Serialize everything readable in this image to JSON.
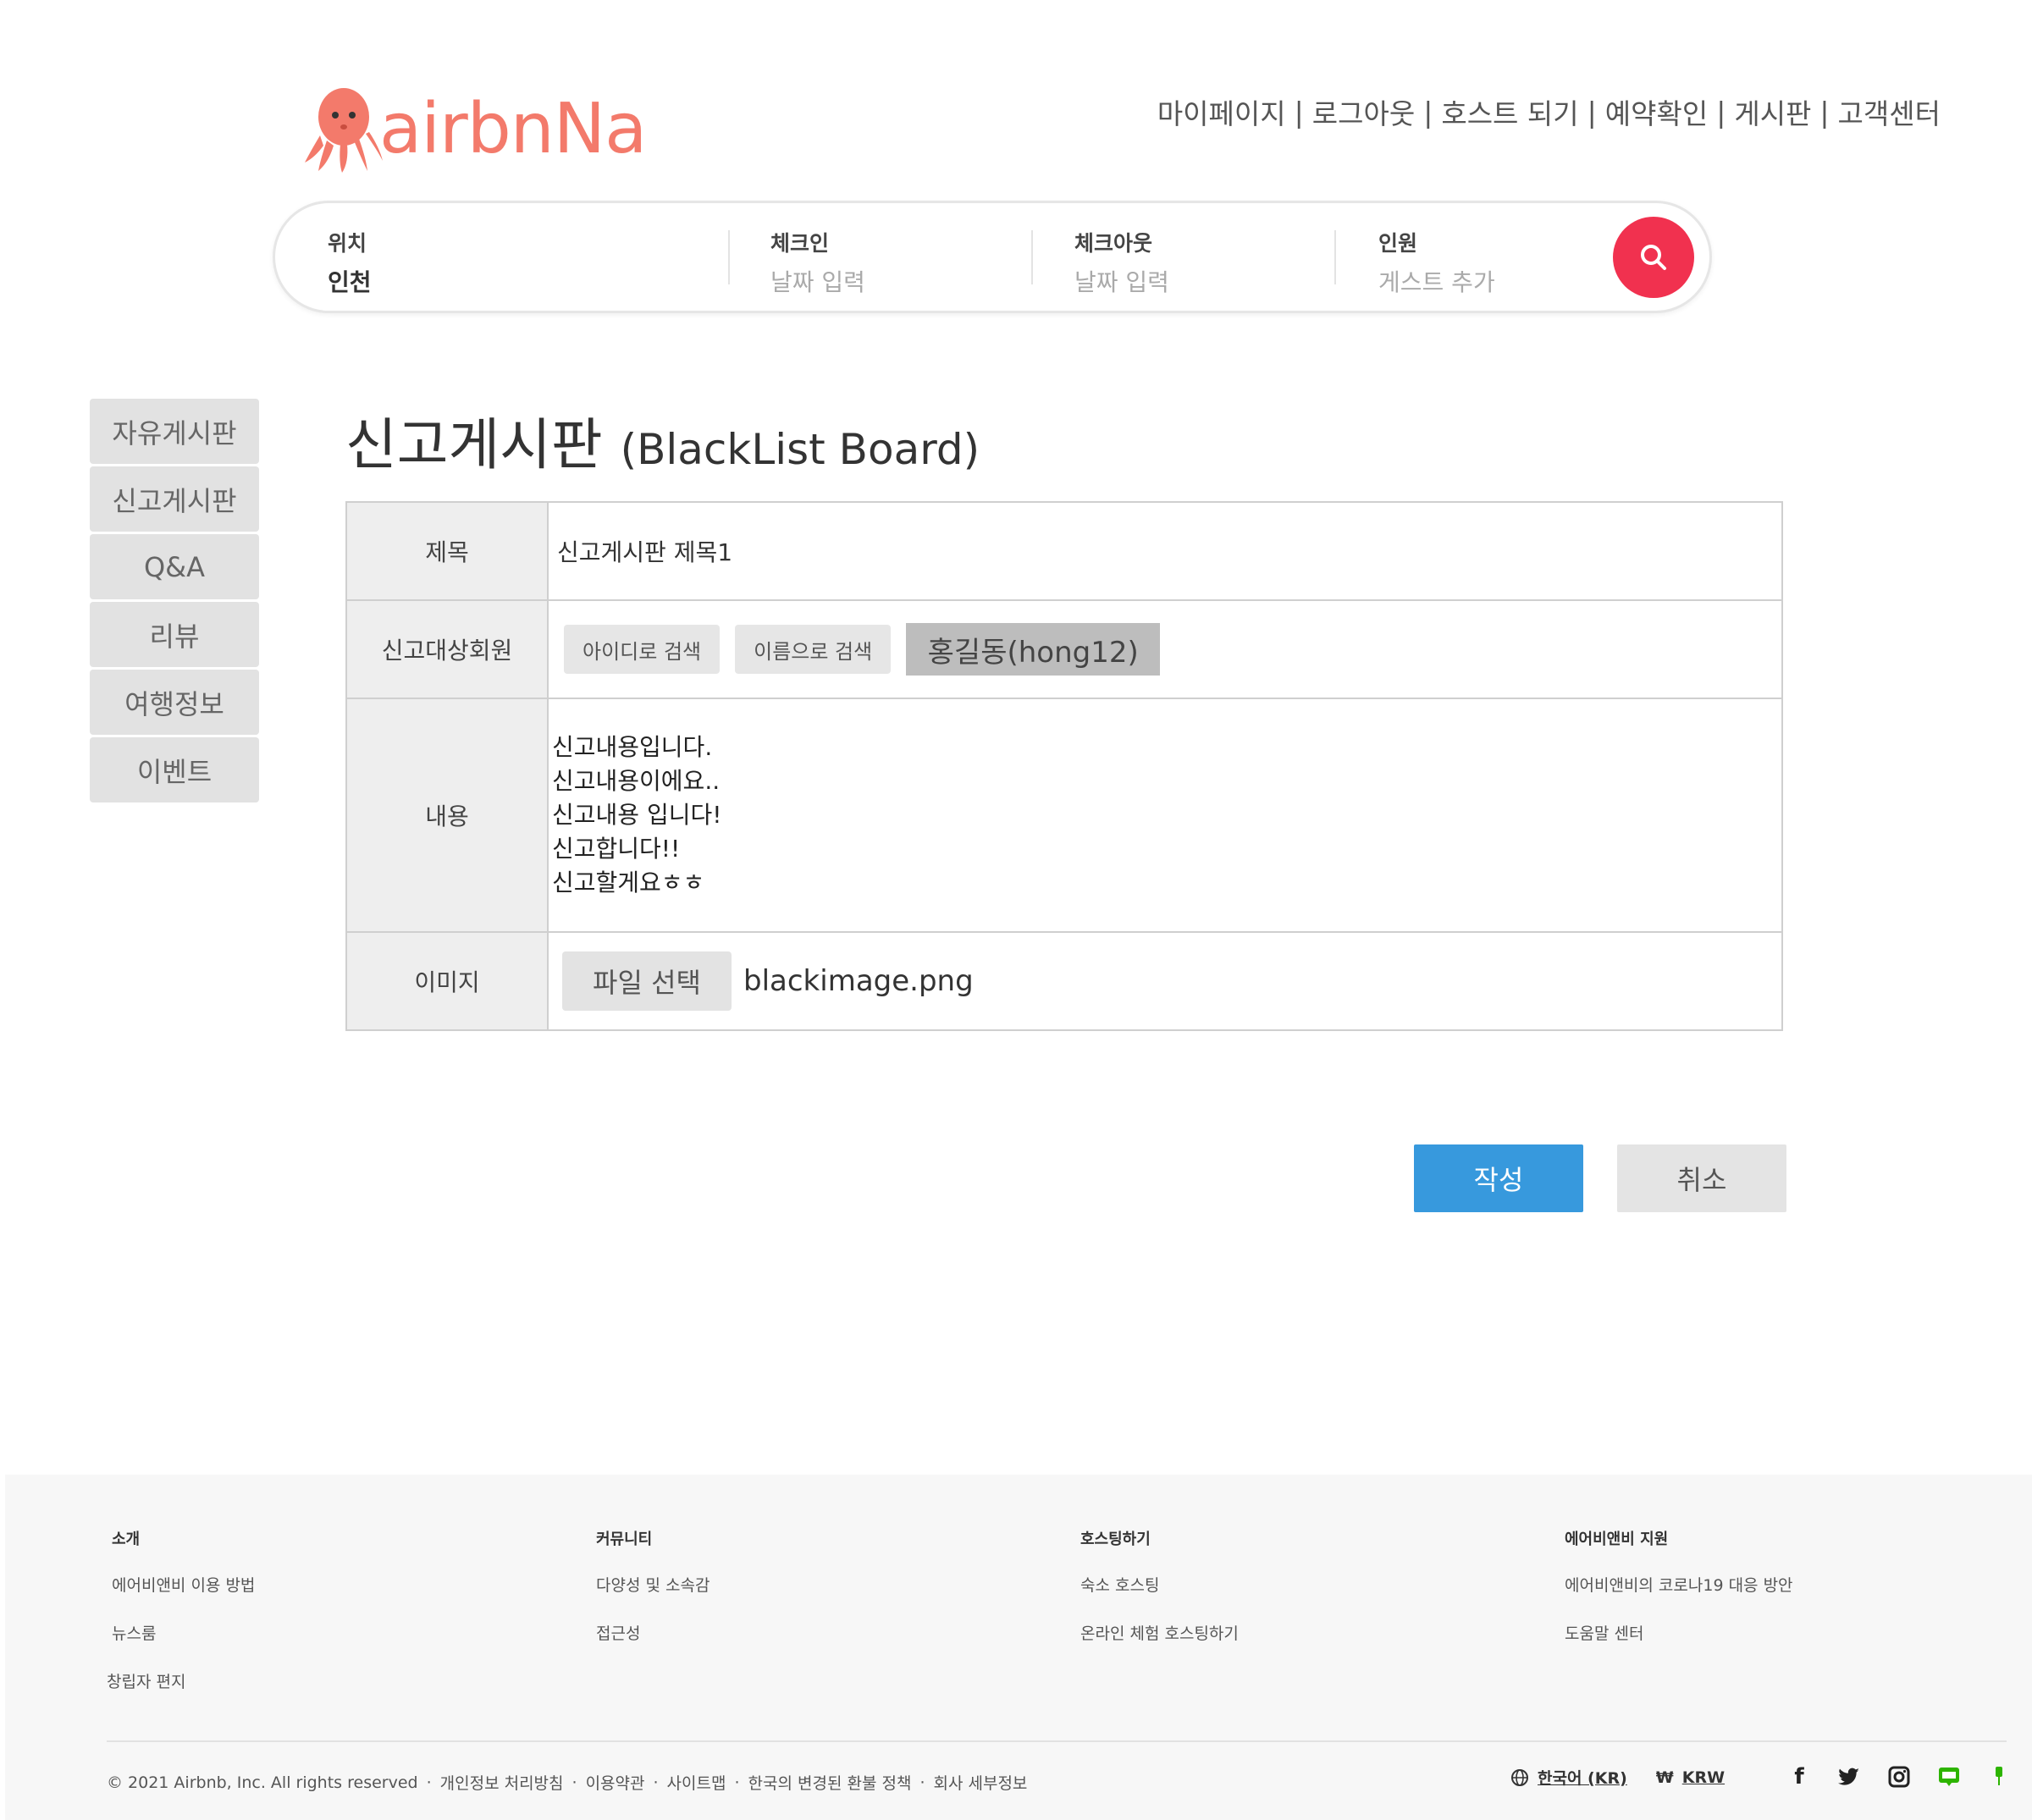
{
  "brand": {
    "name": "airbnNa"
  },
  "topnav": [
    "마이페이지",
    "로그아웃",
    "호스트 되기",
    "예약확인",
    "게시판",
    "고객센터"
  ],
  "search": {
    "location_label": "위치",
    "location_value": "인천",
    "checkin_label": "체크인",
    "checkin_placeholder": "날짜 입력",
    "checkout_label": "체크아웃",
    "checkout_placeholder": "날짜 입력",
    "guests_label": "인원",
    "guests_placeholder": "게스트 추가"
  },
  "sidebar": {
    "items": [
      {
        "label": "자유게시판"
      },
      {
        "label": "신고게시판"
      },
      {
        "label": "Q&A"
      },
      {
        "label": "리뷰"
      },
      {
        "label": "여행정보"
      },
      {
        "label": "이벤트"
      }
    ]
  },
  "page": {
    "title": "신고게시판",
    "subtitle": "(BlackList Board)"
  },
  "form": {
    "title_label": "제목",
    "title_value": "신고게시판 제목1",
    "member_label": "신고대상회원",
    "search_by_id": "아이디로 검색",
    "search_by_name": "이름으로 검색",
    "member_value": "홍길동(hong12)",
    "content_label": "내용",
    "content_lines": [
      "신고내용입니다.",
      "신고내용이에요..",
      "신고내용 입니다!",
      "신고합니다!!",
      "신고할게요ㅎㅎ"
    ],
    "image_label": "이미지",
    "file_button": "파일 선택",
    "file_name": "blackimage.png"
  },
  "actions": {
    "submit": "작성",
    "cancel": "취소"
  },
  "footer": {
    "columns": [
      {
        "heading": "소개",
        "links": [
          "에어비앤비 이용 방법",
          "뉴스룸",
          "창립자 편지"
        ]
      },
      {
        "heading": "커뮤니티",
        "links": [
          "다양성 및 소속감",
          "접근성"
        ]
      },
      {
        "heading": "호스팅하기",
        "links": [
          "숙소 호스팅",
          "온라인 체험 호스팅하기"
        ]
      },
      {
        "heading": "에어비앤비 지원",
        "links": [
          "에어비앤비의 코로나19 대응 방안",
          "도움말 센터"
        ]
      }
    ],
    "bottom_links": [
      "© 2021 Airbnb, Inc. All rights reserved",
      "개인정보 처리방침",
      "이용약관",
      "사이트맵",
      "한국의 변경된 환불 정책",
      "회사 세부정보"
    ],
    "language": "한국어 (KR)",
    "currency_symbol": "₩",
    "currency": "KRW",
    "social_icons": [
      "facebook-icon",
      "twitter-icon",
      "instagram-icon",
      "naver-blog-icon",
      "naver-post-icon"
    ]
  },
  "colors": {
    "brand": "#f37a6b",
    "search_button": "#f1314f",
    "submit": "#3799dd"
  }
}
